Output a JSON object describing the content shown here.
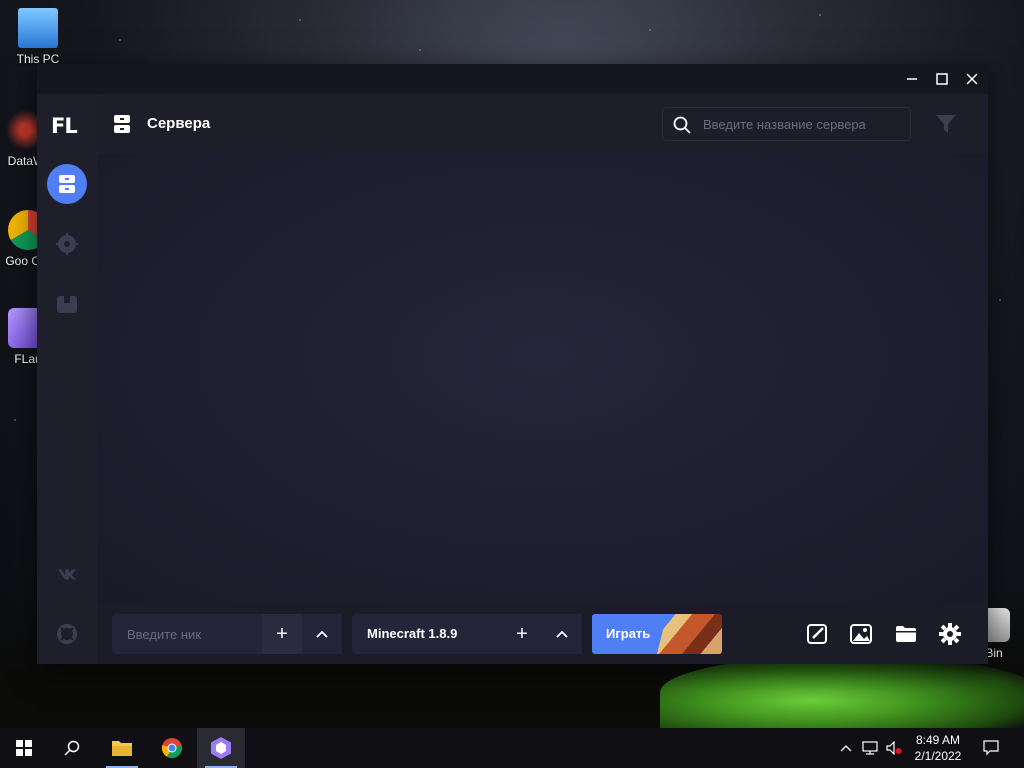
{
  "desktop": {
    "icons": [
      {
        "label": "This PC"
      },
      {
        "label": "DataW"
      },
      {
        "label": "Goo Chr"
      },
      {
        "label": "FLau"
      },
      {
        "label": "Bin"
      }
    ]
  },
  "window": {
    "controls": {
      "minimize": "—",
      "maximize": "☐",
      "close": "✕"
    }
  },
  "sidebar": {
    "logo": "FL",
    "items": [
      {
        "name": "servers",
        "active": true
      },
      {
        "name": "explore",
        "active": false
      },
      {
        "name": "packages",
        "active": false
      }
    ]
  },
  "header": {
    "title": "Сервера",
    "search_placeholder": "Введите название сервера"
  },
  "bottombar": {
    "nick_placeholder": "Введите ник",
    "add_symbol": "+",
    "expand_symbol": "^",
    "version_label": "Minecraft 1.8.9",
    "play_label": "Играть"
  },
  "taskbar": {
    "time": "8:49 AM",
    "date": "2/1/2022"
  },
  "colors": {
    "accent": "#4f7ef5",
    "window_bg": "#16161e",
    "sidebar_bg": "#1f1f2b",
    "content_bg": "#1f1f30"
  }
}
